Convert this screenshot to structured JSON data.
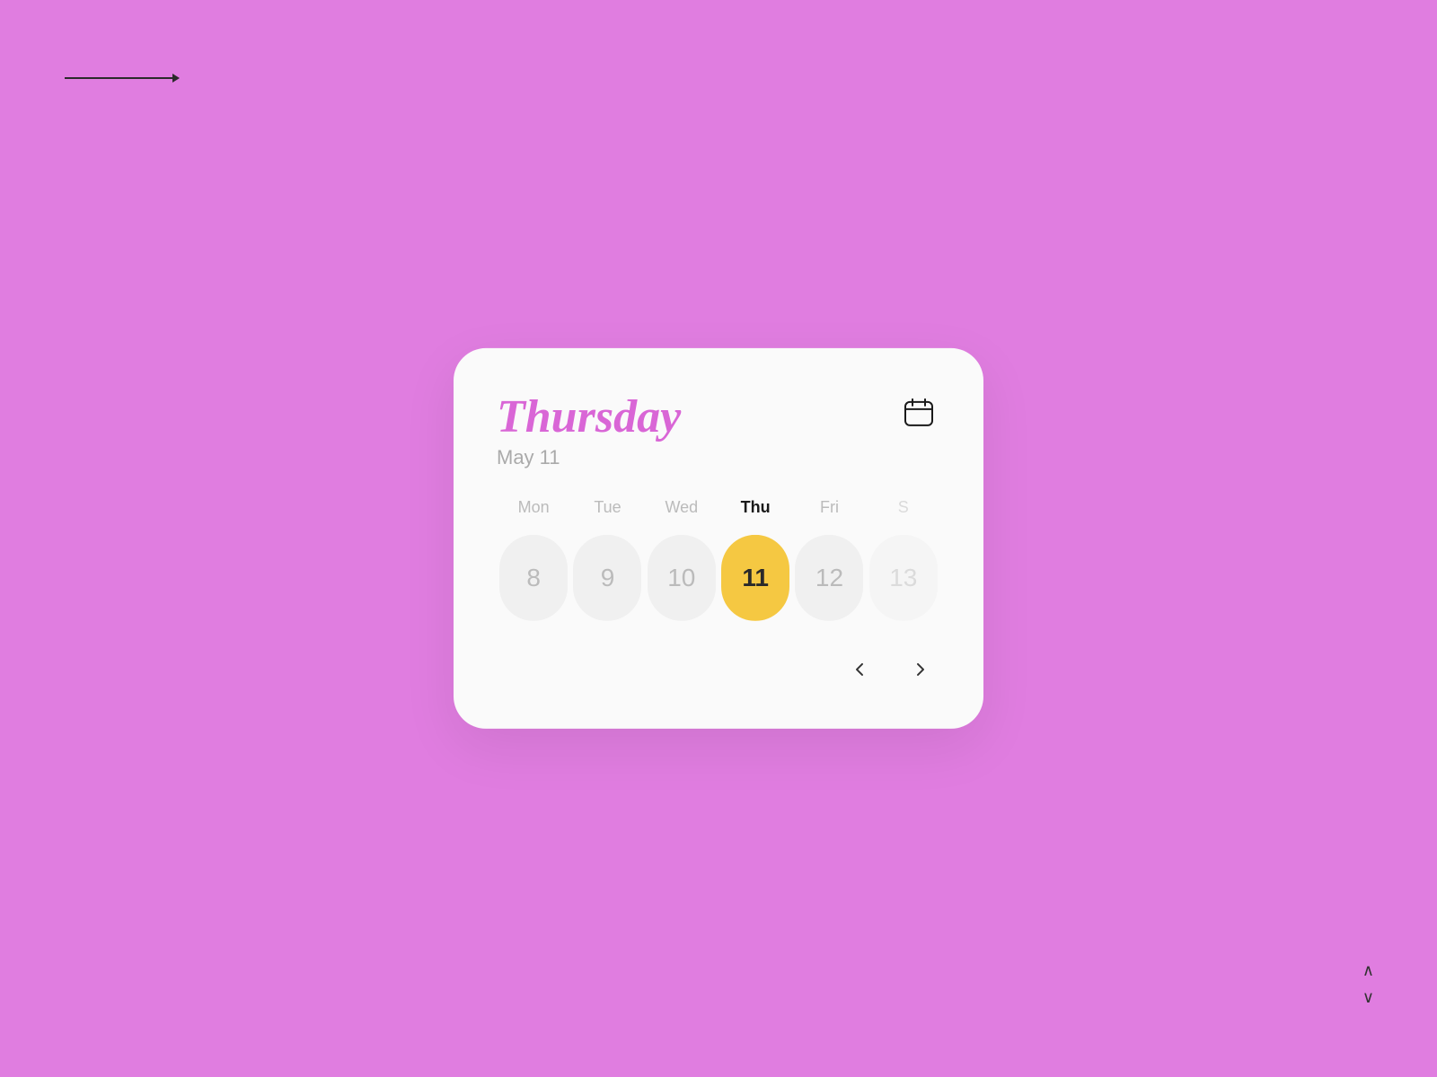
{
  "background": {
    "color": "#e07de0"
  },
  "top_arrow": {
    "aria_label": "right arrow"
  },
  "bottom_chevrons": {
    "up_label": "^",
    "down_label": "v"
  },
  "calendar": {
    "day_name": "Thursday",
    "date_sub": "May 11",
    "calendar_icon_label": "calendar-icon",
    "day_labels": [
      {
        "short": "Mon",
        "active": false
      },
      {
        "short": "Tue",
        "active": false
      },
      {
        "short": "Wed",
        "active": false
      },
      {
        "short": "Thu",
        "active": true
      },
      {
        "short": "Fri",
        "active": false
      },
      {
        "short": "S",
        "active": false,
        "partial": true
      }
    ],
    "day_cells": [
      {
        "number": "8",
        "selected": false,
        "partial": false
      },
      {
        "number": "9",
        "selected": false,
        "partial": false
      },
      {
        "number": "10",
        "selected": false,
        "partial": false
      },
      {
        "number": "11",
        "selected": true,
        "partial": false
      },
      {
        "number": "12",
        "selected": false,
        "partial": false
      },
      {
        "number": "13",
        "selected": false,
        "partial": true
      }
    ],
    "nav_prev": "‹",
    "nav_next": "›"
  }
}
